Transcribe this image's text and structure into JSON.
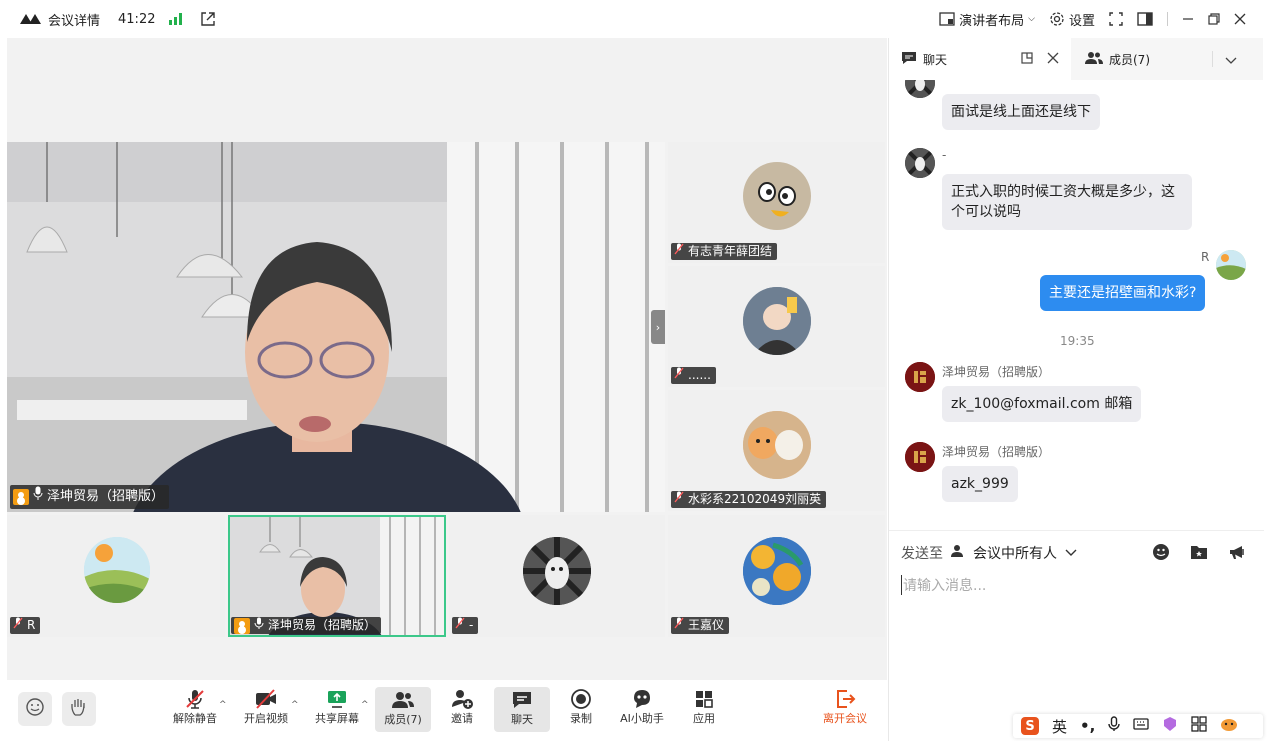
{
  "titlebar": {
    "title": "会议详情",
    "duration": "41:22",
    "layout_label": "演讲者布局",
    "settings_label": "设置"
  },
  "main_speaker": {
    "name": "泽坤贸易（招聘版）"
  },
  "tiles": [
    {
      "name": "有志青年薛团结"
    },
    {
      "name": "......"
    },
    {
      "name": "水彩系22102049刘丽英"
    },
    {
      "name": "R"
    },
    {
      "name": "泽坤贸易（招聘版）"
    },
    {
      "name": "-"
    },
    {
      "name": "王嘉仪"
    }
  ],
  "toolbar": {
    "unmute": "解除静音",
    "start_video": "开启视频",
    "share_screen": "共享屏幕",
    "members": "成员(7)",
    "invite": "邀请",
    "chat": "聊天",
    "record": "录制",
    "ai_assistant": "AI小助手",
    "apps": "应用",
    "leave": "离开会议"
  },
  "panel": {
    "tab_chat": "聊天",
    "tab_members": "成员(7)"
  },
  "chat": {
    "messages": [
      {
        "sender": "",
        "text": "面试是线上面还是线下"
      },
      {
        "sender": "-",
        "text": "正式入职的时候工资大概是多少，这个可以说吗"
      },
      {
        "sender": "R",
        "text": "主要还是招壁画和水彩?"
      },
      {
        "sender": "泽坤贸易（招聘版）",
        "text": "zk_100@foxmail.com  邮箱"
      },
      {
        "sender": "泽坤贸易（招聘版）",
        "text": "azk_999"
      }
    ],
    "time_separator": "19:35"
  },
  "composer": {
    "send_to_label": "发送至",
    "recipient": "会议中所有人",
    "placeholder": "请输入消息..."
  },
  "ime": {
    "lang": "英"
  },
  "colors": {
    "accent_blue": "#2d8cf0",
    "leave_red": "#e8531d",
    "signal_green": "#22b14c",
    "active_tile_border": "#3cc88a"
  }
}
